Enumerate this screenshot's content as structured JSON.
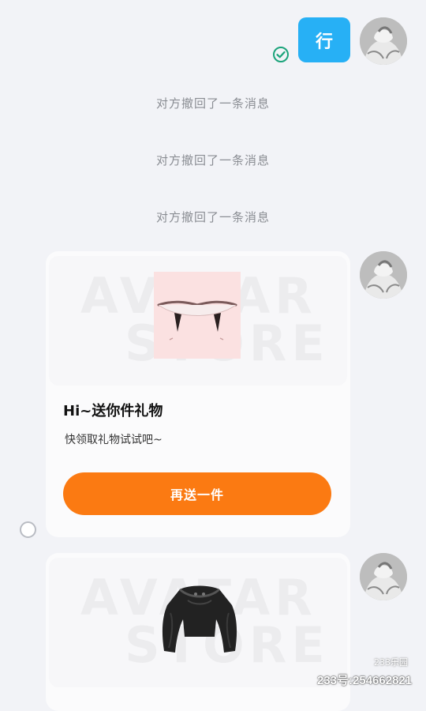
{
  "chat": {
    "my_message": "行",
    "recall_notices": [
      "对方撤回了一条消息",
      "对方撤回了一条消息",
      "对方撤回了一条消息"
    ]
  },
  "gift_card": {
    "watermark_top": "AVATAR",
    "watermark_bottom": "STORE",
    "title": "Hi~送你件礼物",
    "subtitle": "快领取礼物试试吧~",
    "button_label": "再送一件"
  },
  "gift_card_2": {
    "watermark_top": "AVATAR",
    "watermark_bottom": "STORE"
  },
  "overlay": {
    "logo_text": "233乐园",
    "id_text": "233号:254662821"
  },
  "colors": {
    "bubble": "#27b0f5",
    "button": "#fb7a12",
    "background": "#f2f3f7"
  }
}
